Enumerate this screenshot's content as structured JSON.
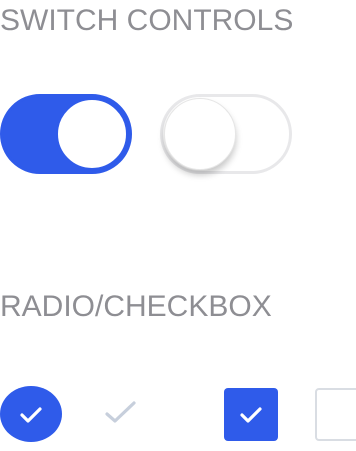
{
  "switch_section": {
    "title": "SWITCH CONTROLS",
    "switches": [
      {
        "state": "on"
      },
      {
        "state": "off"
      }
    ]
  },
  "selection_section": {
    "title": "RADIO/CHECKBOX",
    "controls": [
      {
        "type": "radio",
        "checked": true
      },
      {
        "type": "checkmark",
        "checked": false
      },
      {
        "type": "checkbox",
        "checked": true
      },
      {
        "type": "checkbox",
        "checked": false
      }
    ]
  },
  "colors": {
    "accent": "#2f5bea",
    "title": "#8e8e93",
    "inactive_check": "#c7cfdc",
    "off_border": "#e8e8ea"
  }
}
